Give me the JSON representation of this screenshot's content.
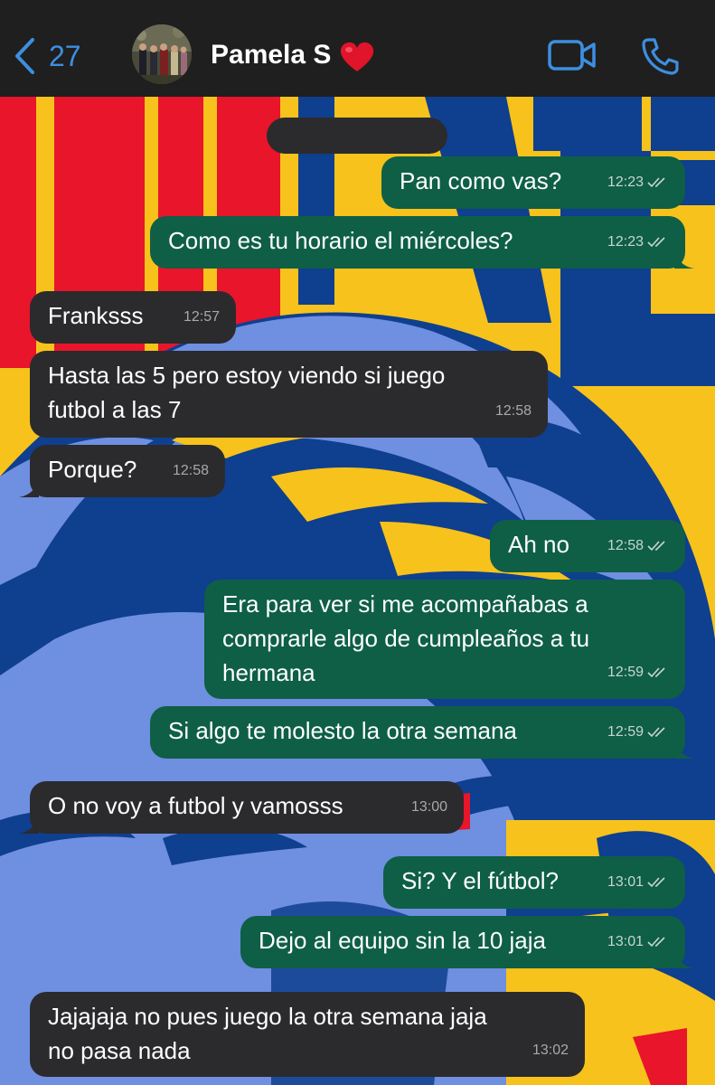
{
  "header": {
    "back_count": "27",
    "contact_name": "Pamela S"
  },
  "messages": [
    {
      "dir": "out",
      "text": "Pan como vas?",
      "time": "12:23"
    },
    {
      "dir": "out",
      "text": "Como es tu horario el miércoles?",
      "time": "12:23"
    },
    {
      "dir": "in",
      "text": "Franksss",
      "time": "12:57"
    },
    {
      "dir": "in",
      "text": "Hasta las 5 pero estoy viendo si juego\nfutbol a las 7",
      "time": "12:58"
    },
    {
      "dir": "in",
      "text": "Porque?",
      "time": "12:58"
    },
    {
      "dir": "out",
      "text": "Ah no",
      "time": "12:58"
    },
    {
      "dir": "out",
      "text": "Era para ver si me acompañabas a\ncomprarle algo de cumpleaños a tu\nhermana",
      "time": "12:59"
    },
    {
      "dir": "out",
      "text": "Si algo te molesto la otra semana",
      "time": "12:59"
    },
    {
      "dir": "in",
      "text": "O no voy a futbol y vamosss",
      "time": "13:00"
    },
    {
      "dir": "out",
      "text": "Si? Y el fútbol?",
      "time": "13:01"
    },
    {
      "dir": "out",
      "text": "Dejo al equipo sin la 10 jaja",
      "time": "13:01"
    },
    {
      "dir": "in",
      "text": "Jajajaja no pues juego la otra semana jaja\nno pasa nada",
      "time": "13:02"
    }
  ],
  "colors": {
    "header_bg": "#1f1f1f",
    "accent": "#3d8fe0",
    "outgoing_bubble": "#0e5f45",
    "incoming_bubble": "#2b2b2d",
    "wallpaper_yellow": "#f7c21b",
    "wallpaper_blue": "#0f3f8f",
    "wallpaper_light_blue": "#6f8fe0",
    "wallpaper_red": "#e8152b"
  },
  "icons": {
    "back": "chevron-left-icon",
    "video": "video-camera-icon",
    "call": "phone-icon",
    "read": "double-check-icon",
    "heart": "red-heart-emoji"
  }
}
